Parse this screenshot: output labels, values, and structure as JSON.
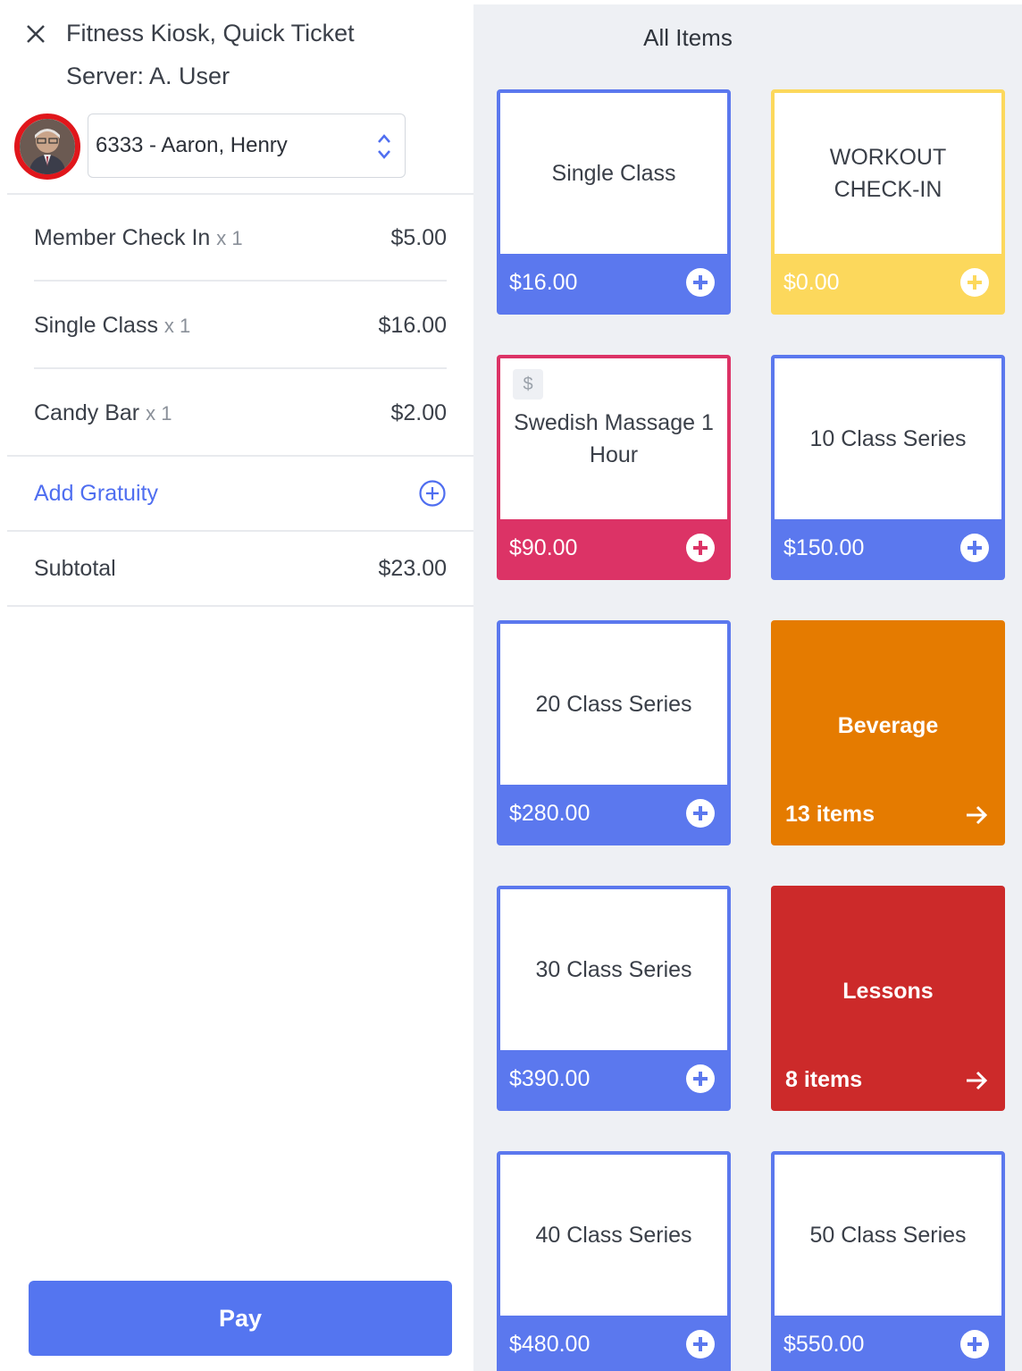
{
  "header": {
    "title": "Fitness Kiosk, Quick Ticket",
    "server": "Server: A. User"
  },
  "member": {
    "selected": "6333 - Aaron, Henry"
  },
  "ticket": {
    "items": [
      {
        "name": "Member Check In",
        "qty": "x 1",
        "price": "$5.00"
      },
      {
        "name": "Single Class",
        "qty": "x 1",
        "price": "$16.00"
      },
      {
        "name": "Candy Bar",
        "qty": "x 1",
        "price": "$2.00"
      }
    ],
    "gratuity_label": "Add Gratuity",
    "subtotal_label": "Subtotal",
    "subtotal_value": "$23.00",
    "pay_label": "Pay"
  },
  "catalog": {
    "heading": "All Items",
    "tiles": [
      {
        "type": "item",
        "name": "Single Class",
        "price": "$16.00",
        "color": "#5b78ee"
      },
      {
        "type": "item",
        "name": "WORKOUT CHECK-IN",
        "price": "$0.00",
        "color": "#fcd85c"
      },
      {
        "type": "item",
        "name": "Swedish Massage 1 Hour",
        "price": "$90.00",
        "color": "#dc3366",
        "badge": "$"
      },
      {
        "type": "item",
        "name": "10 Class Series",
        "price": "$150.00",
        "color": "#5b78ee"
      },
      {
        "type": "item",
        "name": "20 Class Series",
        "price": "$280.00",
        "color": "#5b78ee"
      },
      {
        "type": "category",
        "name": "Beverage",
        "count": "13 items",
        "color": "#e57b00"
      },
      {
        "type": "item",
        "name": "30 Class Series",
        "price": "$390.00",
        "color": "#5b78ee"
      },
      {
        "type": "category",
        "name": "Lessons",
        "count": "8 items",
        "color": "#cc2a2a"
      },
      {
        "type": "item",
        "name": "40 Class Series",
        "price": "$480.00",
        "color": "#5b78ee"
      },
      {
        "type": "item",
        "name": "50 Class Series",
        "price": "$550.00",
        "color": "#5b78ee"
      }
    ]
  }
}
